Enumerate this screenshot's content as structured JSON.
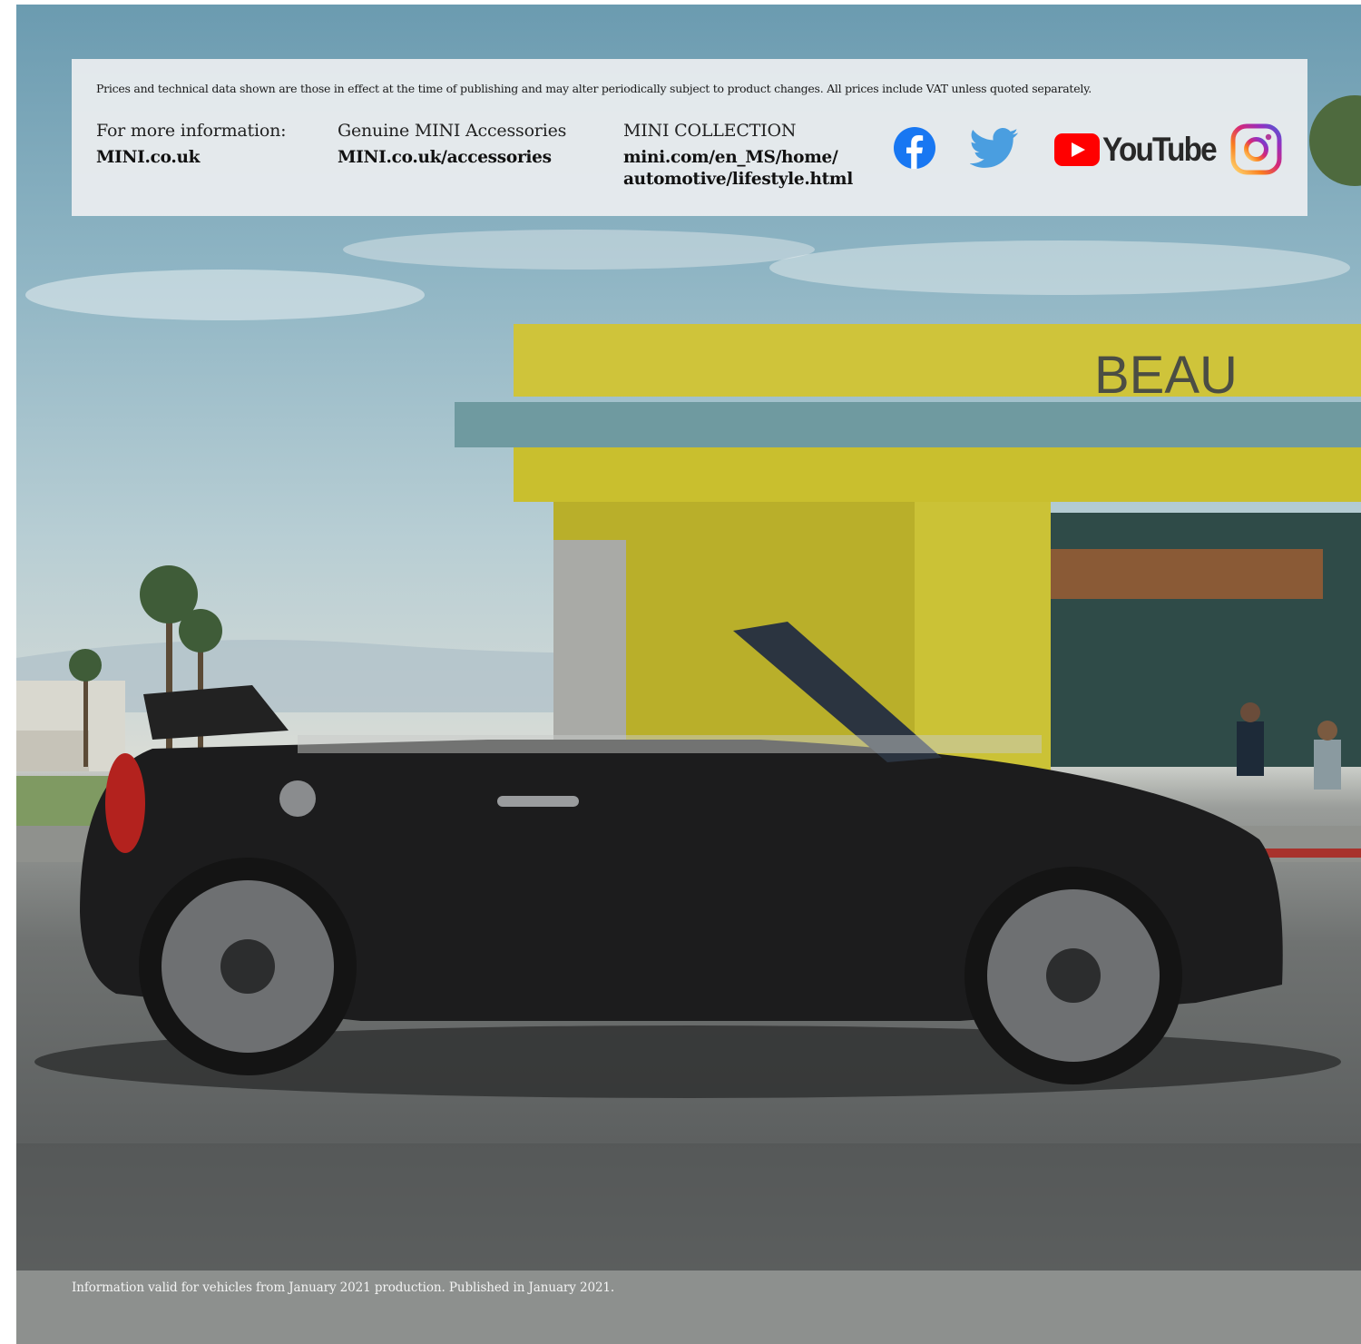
{
  "disclaimer": "Prices and technical data shown are those in effect at the time of publishing and may alter periodically subject to product changes. All prices include VAT unless quoted separately.",
  "columns": [
    {
      "label": "For more information:",
      "link": "MINI.co.uk"
    },
    {
      "label": "Genuine MINI Accessories",
      "link": "MINI.co.uk/accessories"
    },
    {
      "label": "MINI COLLECTION",
      "link_line1": "mini.com/en_MS/home/",
      "link_line2": "automotive/lifestyle.html"
    }
  ],
  "social": {
    "icons": [
      "facebook-icon",
      "twitter-icon",
      "youtube-icon",
      "instagram-icon"
    ],
    "youtube_label": "YouTube",
    "colors": {
      "facebook": "#1877F2",
      "twitter": "#4A9EE0",
      "youtube": "#FF0000",
      "youtube_text": "#282828"
    }
  },
  "photo": {
    "sign_text": "BEAU"
  },
  "footer_note": "Information valid for vehicles from January 2021 production. Published in January 2021."
}
